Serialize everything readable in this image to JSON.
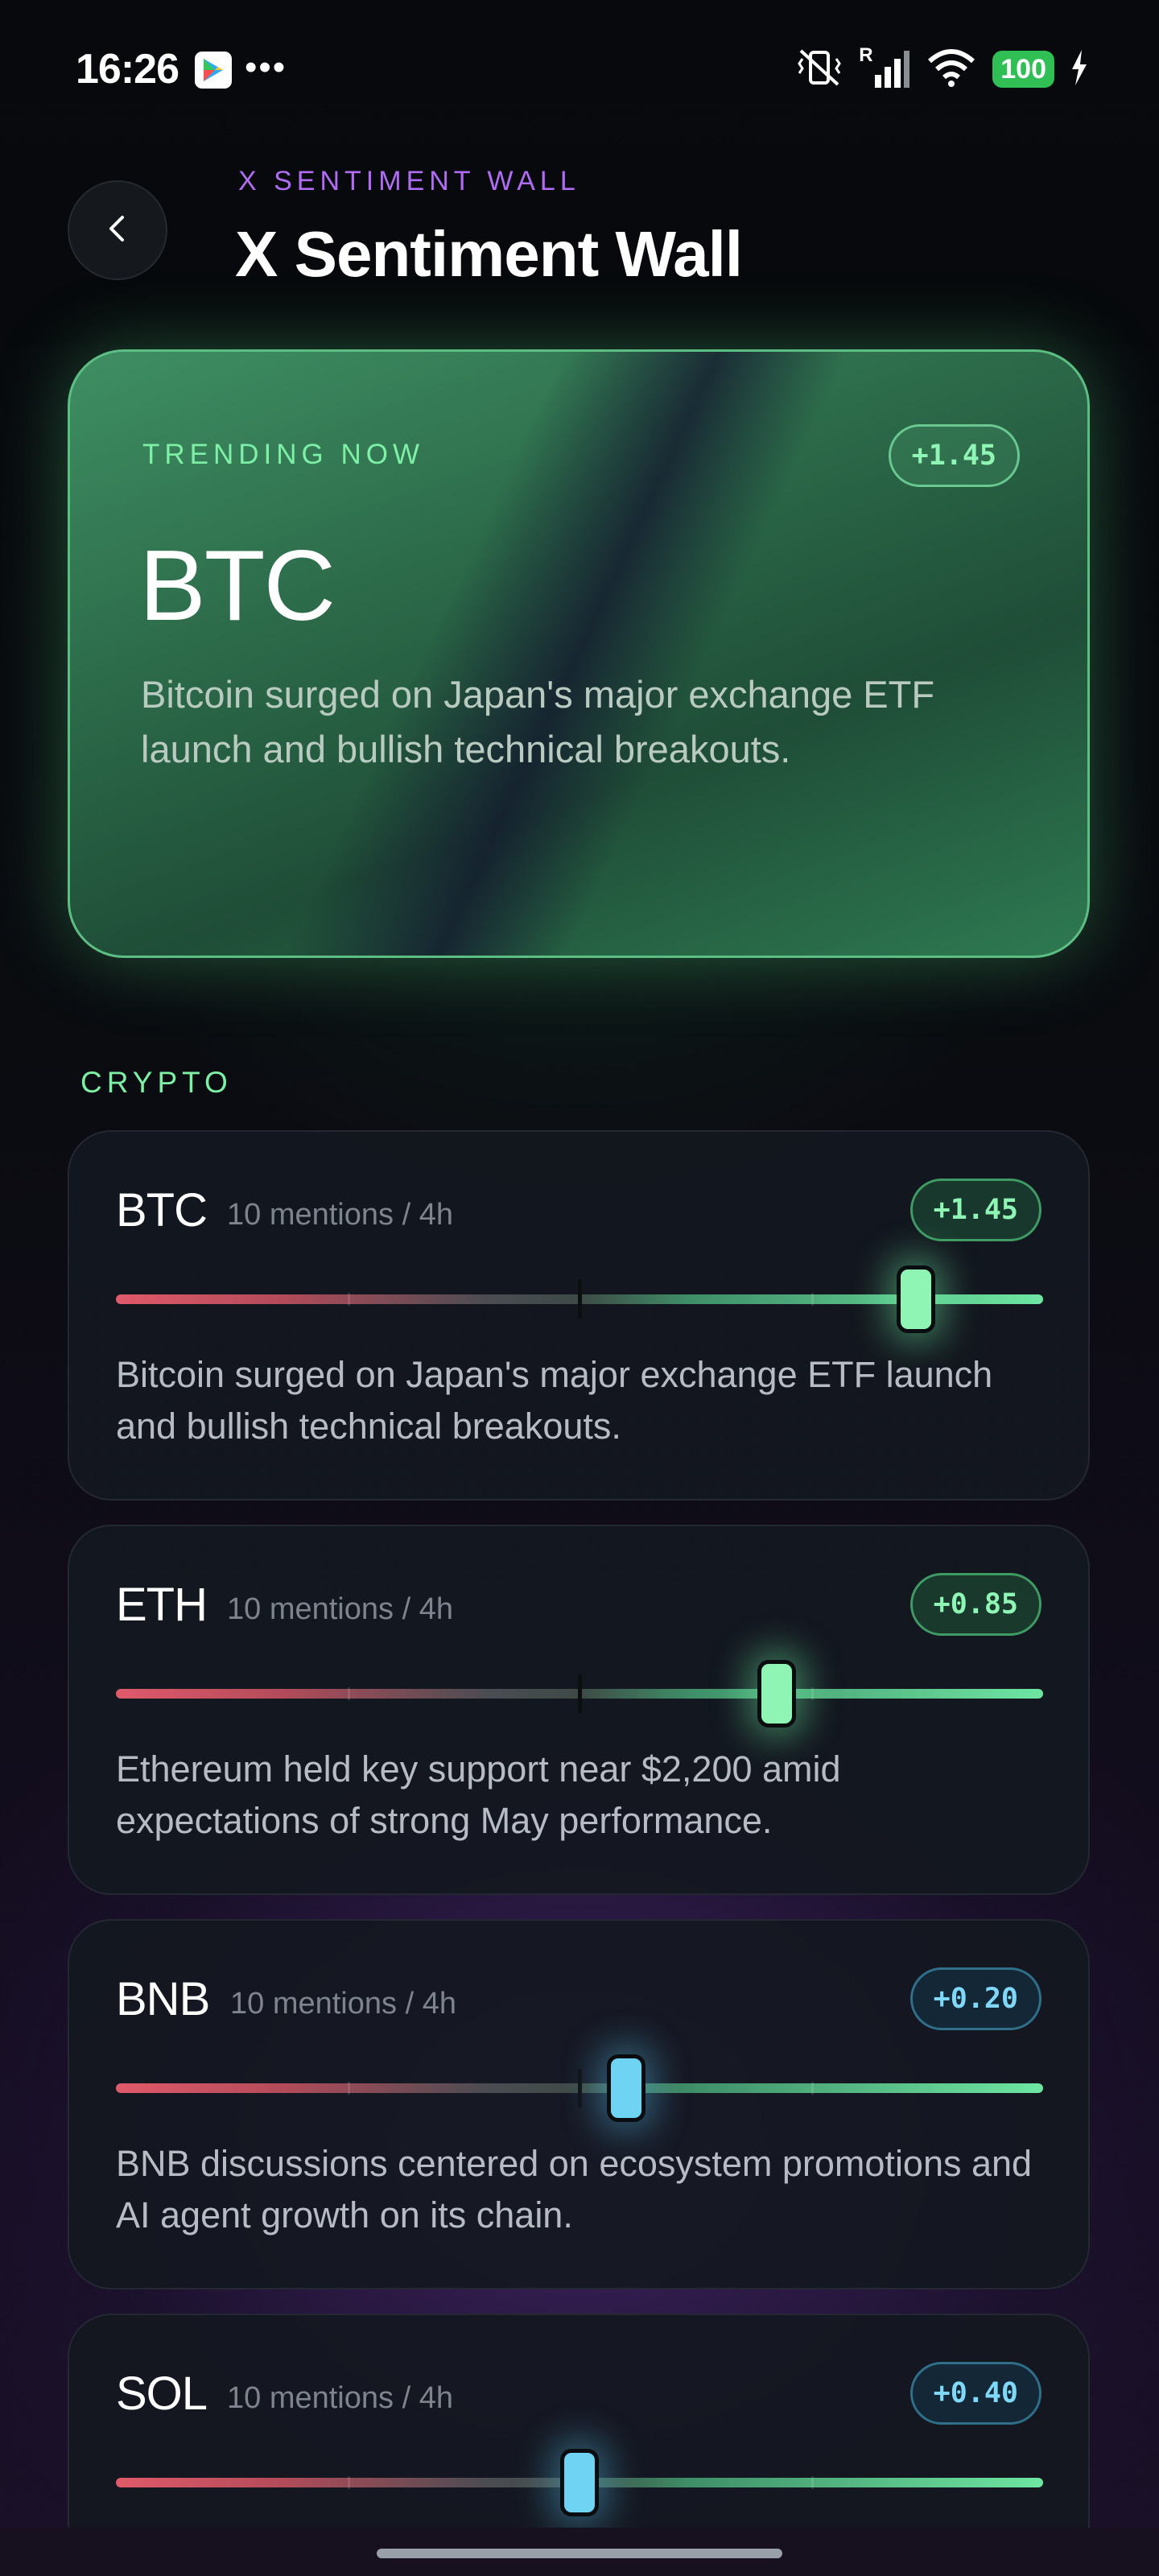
{
  "status_bar": {
    "time": "16:26",
    "battery": "100",
    "network_label": "R",
    "icons": [
      "play-store-icon",
      "more-dots-icon",
      "vibrate-mute-icon",
      "signal-icon",
      "wifi-icon",
      "charging-icon"
    ]
  },
  "header": {
    "kicker": "X SENTIMENT WALL",
    "title": "X Sentiment Wall",
    "back_icon": "chevron-left-icon"
  },
  "trending": {
    "kicker": "TRENDING NOW",
    "ticker": "BTC",
    "score": "+1.45",
    "score_value": 1.45,
    "description": "Bitcoin surged on Japan's major exchange ETF launch and bullish technical breakouts."
  },
  "slider_range": [
    -2,
    2
  ],
  "section_title": "CRYPTO",
  "cards": [
    {
      "ticker": "BTC",
      "mentions": "10 mentions / 4h",
      "score": "+1.45",
      "score_value": 1.45,
      "tone": "green",
      "description": "Bitcoin surged on Japan's major exchange ETF launch and bullish technical breakouts."
    },
    {
      "ticker": "ETH",
      "mentions": "10 mentions / 4h",
      "score": "+0.85",
      "score_value": 0.85,
      "tone": "green",
      "description": "Ethereum held key support near $2,200 amid expectations of strong May performance."
    },
    {
      "ticker": "BNB",
      "mentions": "10 mentions / 4h",
      "score": "+0.20",
      "score_value": 0.2,
      "tone": "blue",
      "description": "BNB discussions centered on ecosystem promotions and AI agent growth on its chain."
    },
    {
      "ticker": "SOL",
      "mentions": "10 mentions / 4h",
      "score": "+0.40",
      "score_value": 0.0,
      "tone": "blue",
      "description": ""
    }
  ],
  "colors": {
    "accent_purple": "#b06cf2",
    "accent_green": "#7df0a6",
    "negative_red": "#e05a6a",
    "thumb_blue": "#6fd3f3"
  }
}
